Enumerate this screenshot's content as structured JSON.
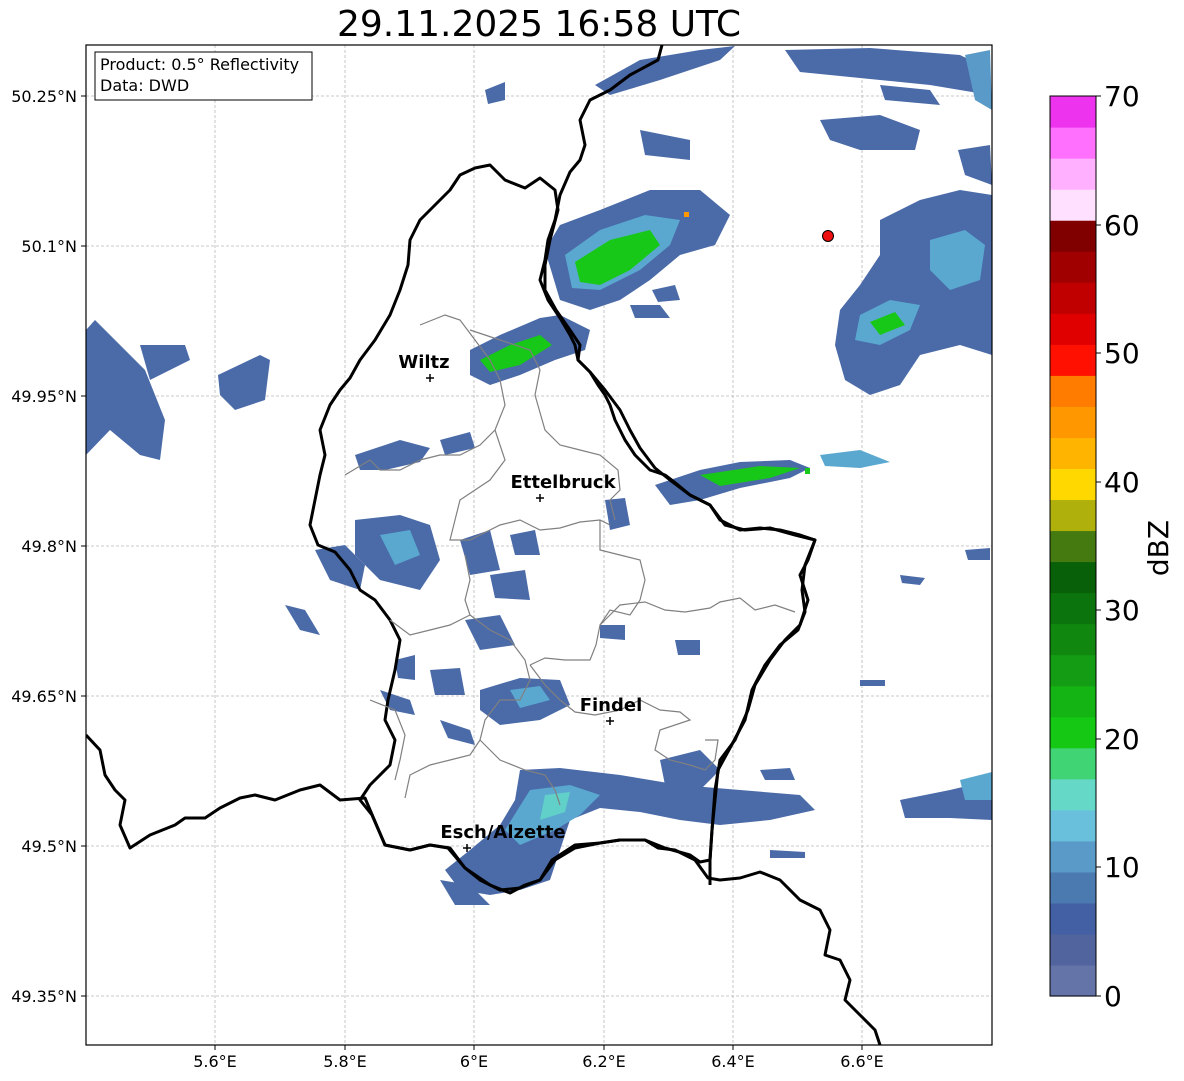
{
  "title": "29.11.2025 16:58 UTC",
  "info_box": {
    "product": "Product: 0.5° Reflectivity",
    "data": "Data: DWD"
  },
  "map": {
    "lat_ticks": [
      "50.25°N",
      "50.1°N",
      "49.95°N",
      "49.8°N",
      "49.65°N",
      "49.5°N",
      "49.35°N"
    ],
    "lon_ticks": [
      "5.6°E",
      "5.8°E",
      "6°E",
      "6.2°E",
      "6.4°E",
      "6.6°E"
    ],
    "grid": true,
    "cities": [
      {
        "name": "Wiltz",
        "lon": 5.93,
        "lat": 49.97
      },
      {
        "name": "Ettelbruck",
        "lon": 6.1,
        "lat": 49.85
      },
      {
        "name": "Findel",
        "lon": 6.21,
        "lat": 49.63
      },
      {
        "name": "Esch/Alzette",
        "lon": 5.99,
        "lat": 49.5
      }
    ],
    "radar_site_color": "#ee1111"
  },
  "colorbar": {
    "label": "dBZ",
    "ticks": [
      "0",
      "10",
      "20",
      "30",
      "40",
      "50",
      "60",
      "70"
    ],
    "colors": [
      "#6474a8",
      "#52649e",
      "#4460a4",
      "#4b7ab0",
      "#5a9ac8",
      "#68c0dc",
      "#66d8c8",
      "#40d474",
      "#14c814",
      "#14b414",
      "#149c14",
      "#108810",
      "#0c740c",
      "#086008",
      "#447a10",
      "#b0b00c",
      "#ffd800",
      "#ffb400",
      "#ff9800",
      "#ff7c00",
      "#ff1000",
      "#e00000",
      "#c00000",
      "#a00000",
      "#800000",
      "#ffe0ff",
      "#ffb0ff",
      "#ff70ff",
      "#ee33ee"
    ]
  },
  "radar_colors": {
    "light": "#4a6aa8",
    "mid": "#5aa8d0",
    "cyan": "#60d0c8",
    "green": "#18c818",
    "orange": "#ff9800"
  }
}
